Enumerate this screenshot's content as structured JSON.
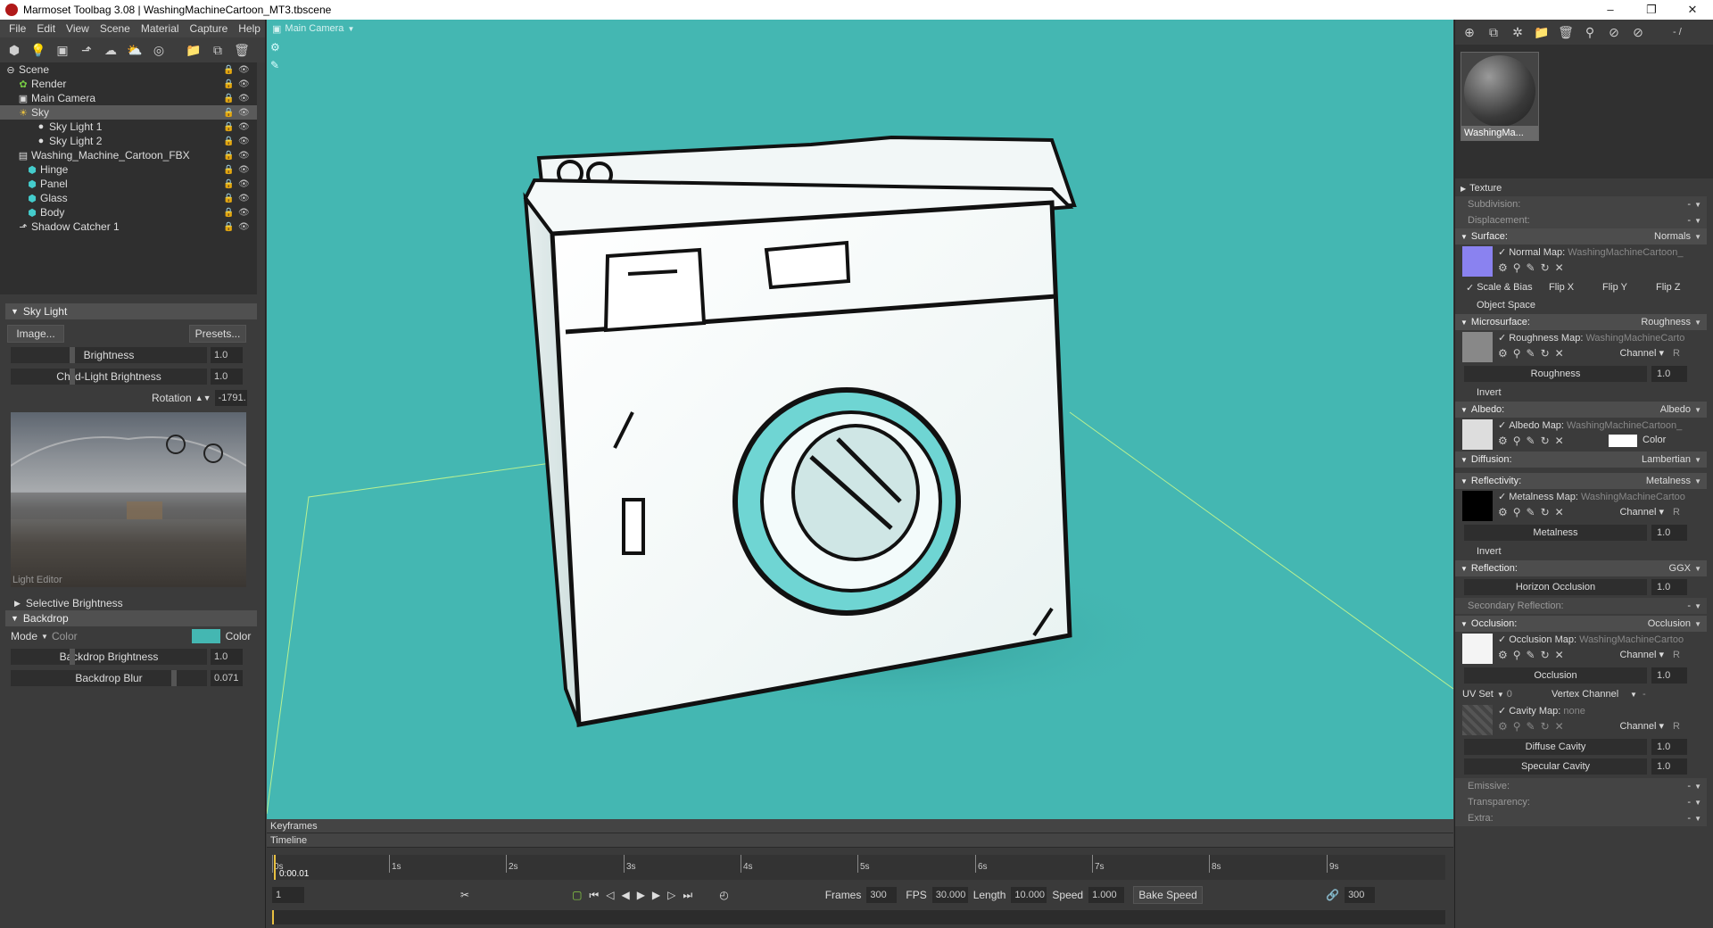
{
  "window": {
    "title": "Marmoset Toolbag 3.08 | WashingMachineCartoon_MT3.tbscene"
  },
  "menu": [
    "File",
    "Edit",
    "View",
    "Scene",
    "Material",
    "Capture",
    "Help"
  ],
  "scene_tree": [
    {
      "label": "Scene",
      "depth": 0,
      "icon": "scene-icon"
    },
    {
      "label": "Render",
      "depth": 1,
      "icon": "render-icon"
    },
    {
      "label": "Main Camera",
      "depth": 1,
      "icon": "camera-icon"
    },
    {
      "label": "Sky",
      "depth": 1,
      "icon": "sky-icon",
      "selected": true
    },
    {
      "label": "Sky Light 1",
      "depth": 2,
      "icon": "light-icon"
    },
    {
      "label": "Sky Light 2",
      "depth": 2,
      "icon": "light-icon"
    },
    {
      "label": "Washing_Machine_Cartoon_FBX",
      "depth": 1,
      "icon": "mesh-icon"
    },
    {
      "label": "Hinge",
      "depth": 2,
      "icon": "mesh-icon"
    },
    {
      "label": "Panel",
      "depth": 2,
      "icon": "mesh-icon"
    },
    {
      "label": "Glass",
      "depth": 2,
      "icon": "mesh-icon"
    },
    {
      "label": "Body",
      "depth": 2,
      "icon": "mesh-icon"
    },
    {
      "label": "Shadow Catcher 1",
      "depth": 1,
      "icon": "shadow-icon"
    }
  ],
  "skylight": {
    "header": "Sky Light",
    "image_btn": "Image...",
    "presets_btn": "Presets...",
    "brightness_label": "Brightness",
    "brightness_value": "1.0",
    "child_label": "Child-Light Brightness",
    "child_value": "1.0",
    "rotation_label": "Rotation",
    "rotation_value": "-1791.",
    "editor_label": "Light Editor",
    "selective": "Selective Brightness"
  },
  "backdrop": {
    "header": "Backdrop",
    "mode_label": "Mode",
    "mode_value": "Color",
    "color_label": "Color",
    "color": "#44b7b2",
    "brightness_label": "Backdrop Brightness",
    "brightness_value": "1.0",
    "blur_label": "Backdrop Blur",
    "blur_value": "0.071"
  },
  "viewport": {
    "camera": "Main Camera",
    "bg": "#44b7b2"
  },
  "timeline": {
    "keyframes": "Keyframes",
    "timeline": "Timeline",
    "time": "0:00.01",
    "ticks": [
      "0s",
      "1s",
      "2s",
      "3s",
      "4s",
      "5s",
      "6s",
      "7s",
      "8s",
      "9s"
    ],
    "frame": "1",
    "frames_label": "Frames",
    "frames_value": "300",
    "fps_label": "FPS",
    "fps_value": "30.000",
    "length_label": "Length",
    "length_value": "10.000",
    "speed_label": "Speed",
    "speed_value": "1.000",
    "bake": "Bake Speed",
    "end_value": "300"
  },
  "material": {
    "name": "WashingMa...",
    "zoom": "- /"
  },
  "props": {
    "texture": "Texture",
    "subdivision": "Subdivision:",
    "displacement": "Displacement:",
    "surface": "Surface:",
    "surface_v": "Normals",
    "normal_map": "Normal Map:",
    "normal_file": "WashingMachineCartoon_",
    "scale_bias": "Scale & Bias",
    "flipx": "Flip X",
    "flipy": "Flip Y",
    "flipz": "Flip Z",
    "object_space": "Object Space",
    "microsurface": "Microsurface:",
    "microsurface_v": "Roughness",
    "rough_map": "Roughness Map:",
    "rough_file": "WashingMachineCarto",
    "channel": "Channel",
    "channel_v": "R",
    "roughness": "Roughness",
    "roughness_v": "1.0",
    "invert": "Invert",
    "albedo": "Albedo:",
    "albedo_v": "Albedo",
    "albedo_map": "Albedo Map:",
    "albedo_file": "WashingMachineCartoon_",
    "color": "Color",
    "diffusion": "Diffusion:",
    "diffusion_v": "Lambertian",
    "reflectivity": "Reflectivity:",
    "reflectivity_v": "Metalness",
    "metal_map": "Metalness Map:",
    "metal_file": "WashingMachineCartoo",
    "metalness": "Metalness",
    "metalness_v": "1.0",
    "reflection": "Reflection:",
    "reflection_v": "GGX",
    "horizon": "Horizon Occlusion",
    "horizon_v": "1.0",
    "secondary": "Secondary Reflection:",
    "occlusion": "Occlusion:",
    "occlusion_v": "Occlusion",
    "occ_map": "Occlusion Map:",
    "occ_file": "WashingMachineCartoo",
    "occlusion_l": "Occlusion",
    "occlusion_n": "1.0",
    "uvset": "UV Set",
    "uvset_v": "0",
    "vertex": "Vertex Channel",
    "vertex_v": "-",
    "cavity_map": "Cavity Map:",
    "cavity_file": "none",
    "diffuse_cavity": "Diffuse Cavity",
    "diffuse_cavity_v": "1.0",
    "specular_cavity": "Specular Cavity",
    "specular_cavity_v": "1.0",
    "emissive": "Emissive:",
    "transparency": "Transparency:",
    "extra": "Extra:",
    "dash": "-"
  }
}
